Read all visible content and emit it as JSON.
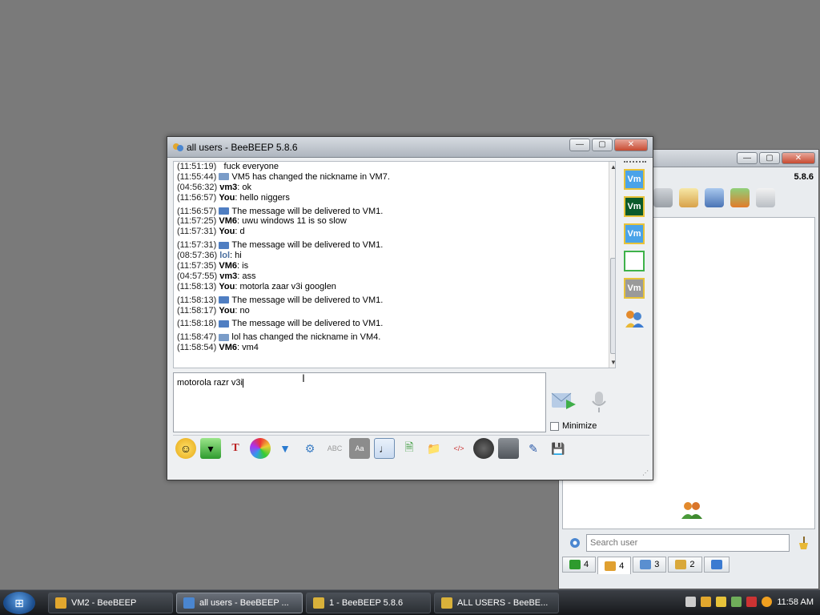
{
  "back_window": {
    "version": "5.8.6",
    "search_placeholder": "Search user",
    "tabs": [
      {
        "count": "4",
        "color": "#2e9b2e"
      },
      {
        "count": "4",
        "color": "#e0a030"
      },
      {
        "count": "3",
        "color": "#5a8fd0"
      },
      {
        "count": "2",
        "color": "#d9a83a"
      },
      {
        "count": "",
        "color": "#3b7bd1"
      }
    ]
  },
  "main_window": {
    "title": "all users - BeeBEEP 5.8.6",
    "chat_lines": [
      {
        "ts": "(11:51:19)",
        "nick": "",
        "text": "fuck everyone",
        "kind": "plain"
      },
      {
        "ts": "(11:55:44)",
        "nick": "",
        "text": "VM5 has changed the nickname in VM7.",
        "kind": "note"
      },
      {
        "ts": "(04:56:32)",
        "nick": "vm3",
        "text": ": ok",
        "kind": "msg"
      },
      {
        "ts": "(11:56:57)",
        "nick": "You",
        "text": ": hello niggers",
        "kind": "msg"
      },
      {
        "ts": "(11:56:57)",
        "nick": "",
        "text": "The message will be delivered to VM1.",
        "kind": "sys"
      },
      {
        "ts": "(11:57:25)",
        "nick": "VM6",
        "text": ": uwu windows 11 is so slow",
        "kind": "msg"
      },
      {
        "ts": "(11:57:31)",
        "nick": "You",
        "text": ": d",
        "kind": "msg"
      },
      {
        "ts": "(11:57:31)",
        "nick": "",
        "text": "The message will be delivered to VM1.",
        "kind": "sys"
      },
      {
        "ts": "(08:57:36)",
        "nick": "lol",
        "text": ": hi",
        "kind": "lol"
      },
      {
        "ts": "(11:57:35)",
        "nick": "VM6",
        "text": ": is",
        "kind": "msg"
      },
      {
        "ts": "(04:57:55)",
        "nick": "vm3",
        "text": ": ass",
        "kind": "msg"
      },
      {
        "ts": "(11:58:13)",
        "nick": "You",
        "text": ": motorla zaar v3i googlen",
        "kind": "msg"
      },
      {
        "ts": "(11:58:13)",
        "nick": "",
        "text": "The message will be delivered to VM1.",
        "kind": "sys"
      },
      {
        "ts": "(11:58:17)",
        "nick": "You",
        "text": ": no",
        "kind": "msg"
      },
      {
        "ts": "(11:58:18)",
        "nick": "",
        "text": "The message will be delivered to VM1.",
        "kind": "sys"
      },
      {
        "ts": "(11:58:47)",
        "nick": "",
        "text": "lol has changed the nickname in VM4.",
        "kind": "note"
      },
      {
        "ts": "(11:58:54)",
        "nick": "VM6",
        "text": ": vm4",
        "kind": "msg"
      }
    ],
    "input_value": "motorola razr v3i",
    "minimize_label": "Minimize",
    "side_avatars": [
      {
        "label": "Vm",
        "bg": "#4aa3e8"
      },
      {
        "label": "Vm",
        "bg": "#0b5a2a"
      },
      {
        "label": "Vm",
        "bg": "#4aa3e8"
      },
      {
        "label": "",
        "bg": "#ffffff"
      },
      {
        "label": "Vm",
        "bg": "#9a9a9a"
      }
    ]
  },
  "taskbar": {
    "items": [
      {
        "label": "VM2 - BeeBEEP",
        "active": false
      },
      {
        "label": "all users - BeeBEEP ...",
        "active": true
      },
      {
        "label": "1 - BeeBEEP 5.8.6",
        "active": false
      },
      {
        "label": "ALL USERS - BeeBE...",
        "active": false
      }
    ],
    "clock": "11:58 AM"
  }
}
